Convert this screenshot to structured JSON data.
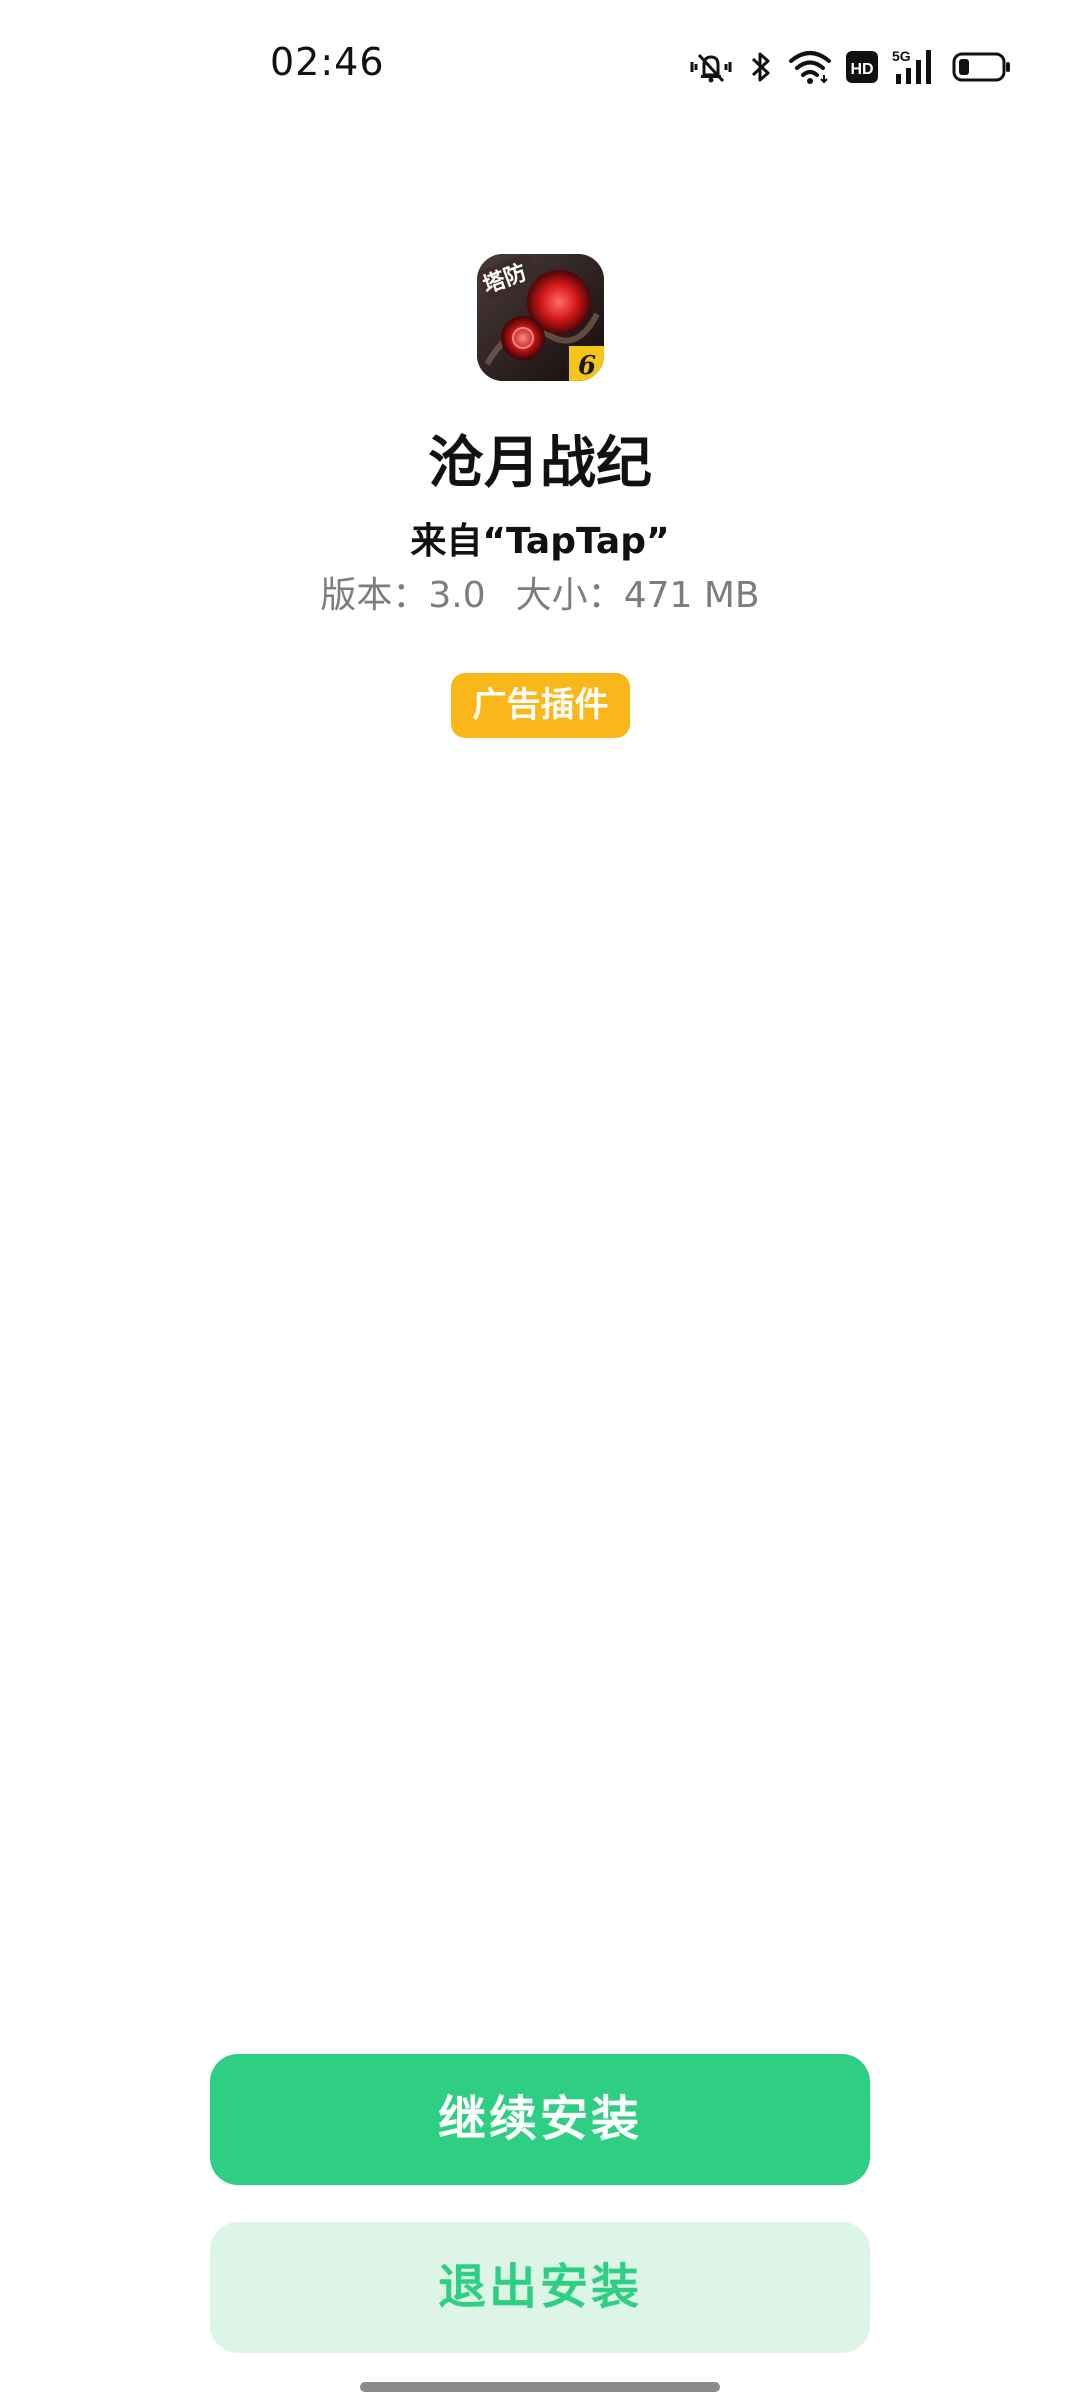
{
  "status_bar": {
    "time": "02:46",
    "icons": [
      "mute-vibrate-icon",
      "bluetooth-icon",
      "wifi-icon",
      "hd-icon",
      "signal-5g-icon",
      "battery-icon"
    ],
    "hd_label": "HD",
    "network_label": "5G",
    "battery_level": 0.25
  },
  "app": {
    "icon_text": "塔防",
    "icon_badge": "6",
    "name": "沧月战纪",
    "source": "来自“TapTap”",
    "version_label": "版本：",
    "version": "3.0",
    "size_label": "大小：",
    "size": "471 MB",
    "badge": "广告插件"
  },
  "actions": {
    "continue_label": "继续安装",
    "exit_label": "退出安装"
  },
  "colors": {
    "accent": "#2ecf82",
    "accent_light": "#dcf5e7",
    "badge": "#f9b71a"
  }
}
